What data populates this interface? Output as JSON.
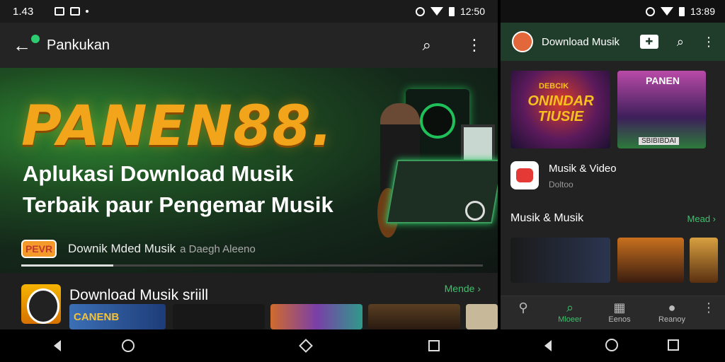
{
  "left": {
    "status": {
      "time": "1.43",
      "clock": "12:50"
    },
    "appbar": {
      "title": "Pankukan"
    },
    "hero": {
      "brand": "PANEN88.",
      "headline_1": "Aplukasi Download Musik",
      "headline_2": "Terbaik paur Pengemar Musik"
    },
    "promo": {
      "badge": "PEVR",
      "text": "Downik Mded Musik",
      "text_2": "a Daegh Aleeno",
      "progress": 0.2
    },
    "section": {
      "title": "Download Musik sriill",
      "more": "Mende ›"
    },
    "cards": [
      "CANENB",
      "",
      "",
      "",
      ""
    ]
  },
  "right": {
    "status": {
      "clock": "13:89"
    },
    "appbar": {
      "title": "Download Musik"
    },
    "card1": {
      "title": "ONINDAR TIUSIE",
      "top": "DEBCIK"
    },
    "card2": {
      "title": "PANEN",
      "footer": "SBIBIBDAI"
    },
    "item": {
      "title": "Musik & Video",
      "subtitle": "Doltoo"
    },
    "section": {
      "title": "Musik & Musik",
      "more": "Mead ›"
    },
    "tabs": [
      {
        "label": "",
        "icon": "link-icon"
      },
      {
        "label": "Mloeer",
        "icon": "search-icon"
      },
      {
        "label": "Eenos",
        "icon": "map-icon"
      },
      {
        "label": "Reanoy",
        "icon": "person-icon"
      }
    ]
  },
  "colors": {
    "accent": "#3fc06b",
    "brand": "#f2a51a",
    "appbar_right": "#1f3d2a"
  }
}
